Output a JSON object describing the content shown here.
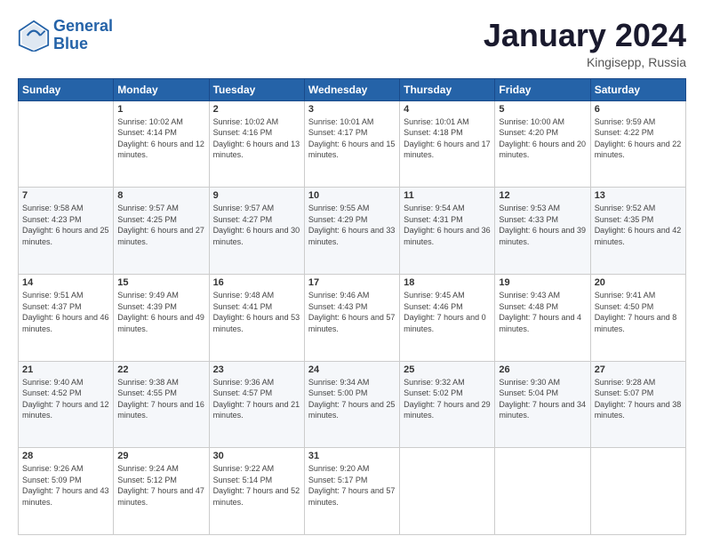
{
  "header": {
    "logo_line1": "General",
    "logo_line2": "Blue",
    "month_title": "January 2024",
    "location": "Kingisepp, Russia"
  },
  "weekdays": [
    "Sunday",
    "Monday",
    "Tuesday",
    "Wednesday",
    "Thursday",
    "Friday",
    "Saturday"
  ],
  "weeks": [
    [
      {
        "day": "",
        "sunrise": "",
        "sunset": "",
        "daylight": ""
      },
      {
        "day": "1",
        "sunrise": "Sunrise: 10:02 AM",
        "sunset": "Sunset: 4:14 PM",
        "daylight": "Daylight: 6 hours and 12 minutes."
      },
      {
        "day": "2",
        "sunrise": "Sunrise: 10:02 AM",
        "sunset": "Sunset: 4:16 PM",
        "daylight": "Daylight: 6 hours and 13 minutes."
      },
      {
        "day": "3",
        "sunrise": "Sunrise: 10:01 AM",
        "sunset": "Sunset: 4:17 PM",
        "daylight": "Daylight: 6 hours and 15 minutes."
      },
      {
        "day": "4",
        "sunrise": "Sunrise: 10:01 AM",
        "sunset": "Sunset: 4:18 PM",
        "daylight": "Daylight: 6 hours and 17 minutes."
      },
      {
        "day": "5",
        "sunrise": "Sunrise: 10:00 AM",
        "sunset": "Sunset: 4:20 PM",
        "daylight": "Daylight: 6 hours and 20 minutes."
      },
      {
        "day": "6",
        "sunrise": "Sunrise: 9:59 AM",
        "sunset": "Sunset: 4:22 PM",
        "daylight": "Daylight: 6 hours and 22 minutes."
      }
    ],
    [
      {
        "day": "7",
        "sunrise": "Sunrise: 9:58 AM",
        "sunset": "Sunset: 4:23 PM",
        "daylight": "Daylight: 6 hours and 25 minutes."
      },
      {
        "day": "8",
        "sunrise": "Sunrise: 9:57 AM",
        "sunset": "Sunset: 4:25 PM",
        "daylight": "Daylight: 6 hours and 27 minutes."
      },
      {
        "day": "9",
        "sunrise": "Sunrise: 9:57 AM",
        "sunset": "Sunset: 4:27 PM",
        "daylight": "Daylight: 6 hours and 30 minutes."
      },
      {
        "day": "10",
        "sunrise": "Sunrise: 9:55 AM",
        "sunset": "Sunset: 4:29 PM",
        "daylight": "Daylight: 6 hours and 33 minutes."
      },
      {
        "day": "11",
        "sunrise": "Sunrise: 9:54 AM",
        "sunset": "Sunset: 4:31 PM",
        "daylight": "Daylight: 6 hours and 36 minutes."
      },
      {
        "day": "12",
        "sunrise": "Sunrise: 9:53 AM",
        "sunset": "Sunset: 4:33 PM",
        "daylight": "Daylight: 6 hours and 39 minutes."
      },
      {
        "day": "13",
        "sunrise": "Sunrise: 9:52 AM",
        "sunset": "Sunset: 4:35 PM",
        "daylight": "Daylight: 6 hours and 42 minutes."
      }
    ],
    [
      {
        "day": "14",
        "sunrise": "Sunrise: 9:51 AM",
        "sunset": "Sunset: 4:37 PM",
        "daylight": "Daylight: 6 hours and 46 minutes."
      },
      {
        "day": "15",
        "sunrise": "Sunrise: 9:49 AM",
        "sunset": "Sunset: 4:39 PM",
        "daylight": "Daylight: 6 hours and 49 minutes."
      },
      {
        "day": "16",
        "sunrise": "Sunrise: 9:48 AM",
        "sunset": "Sunset: 4:41 PM",
        "daylight": "Daylight: 6 hours and 53 minutes."
      },
      {
        "day": "17",
        "sunrise": "Sunrise: 9:46 AM",
        "sunset": "Sunset: 4:43 PM",
        "daylight": "Daylight: 6 hours and 57 minutes."
      },
      {
        "day": "18",
        "sunrise": "Sunrise: 9:45 AM",
        "sunset": "Sunset: 4:46 PM",
        "daylight": "Daylight: 7 hours and 0 minutes."
      },
      {
        "day": "19",
        "sunrise": "Sunrise: 9:43 AM",
        "sunset": "Sunset: 4:48 PM",
        "daylight": "Daylight: 7 hours and 4 minutes."
      },
      {
        "day": "20",
        "sunrise": "Sunrise: 9:41 AM",
        "sunset": "Sunset: 4:50 PM",
        "daylight": "Daylight: 7 hours and 8 minutes."
      }
    ],
    [
      {
        "day": "21",
        "sunrise": "Sunrise: 9:40 AM",
        "sunset": "Sunset: 4:52 PM",
        "daylight": "Daylight: 7 hours and 12 minutes."
      },
      {
        "day": "22",
        "sunrise": "Sunrise: 9:38 AM",
        "sunset": "Sunset: 4:55 PM",
        "daylight": "Daylight: 7 hours and 16 minutes."
      },
      {
        "day": "23",
        "sunrise": "Sunrise: 9:36 AM",
        "sunset": "Sunset: 4:57 PM",
        "daylight": "Daylight: 7 hours and 21 minutes."
      },
      {
        "day": "24",
        "sunrise": "Sunrise: 9:34 AM",
        "sunset": "Sunset: 5:00 PM",
        "daylight": "Daylight: 7 hours and 25 minutes."
      },
      {
        "day": "25",
        "sunrise": "Sunrise: 9:32 AM",
        "sunset": "Sunset: 5:02 PM",
        "daylight": "Daylight: 7 hours and 29 minutes."
      },
      {
        "day": "26",
        "sunrise": "Sunrise: 9:30 AM",
        "sunset": "Sunset: 5:04 PM",
        "daylight": "Daylight: 7 hours and 34 minutes."
      },
      {
        "day": "27",
        "sunrise": "Sunrise: 9:28 AM",
        "sunset": "Sunset: 5:07 PM",
        "daylight": "Daylight: 7 hours and 38 minutes."
      }
    ],
    [
      {
        "day": "28",
        "sunrise": "Sunrise: 9:26 AM",
        "sunset": "Sunset: 5:09 PM",
        "daylight": "Daylight: 7 hours and 43 minutes."
      },
      {
        "day": "29",
        "sunrise": "Sunrise: 9:24 AM",
        "sunset": "Sunset: 5:12 PM",
        "daylight": "Daylight: 7 hours and 47 minutes."
      },
      {
        "day": "30",
        "sunrise": "Sunrise: 9:22 AM",
        "sunset": "Sunset: 5:14 PM",
        "daylight": "Daylight: 7 hours and 52 minutes."
      },
      {
        "day": "31",
        "sunrise": "Sunrise: 9:20 AM",
        "sunset": "Sunset: 5:17 PM",
        "daylight": "Daylight: 7 hours and 57 minutes."
      },
      {
        "day": "",
        "sunrise": "",
        "sunset": "",
        "daylight": ""
      },
      {
        "day": "",
        "sunrise": "",
        "sunset": "",
        "daylight": ""
      },
      {
        "day": "",
        "sunrise": "",
        "sunset": "",
        "daylight": ""
      }
    ]
  ]
}
